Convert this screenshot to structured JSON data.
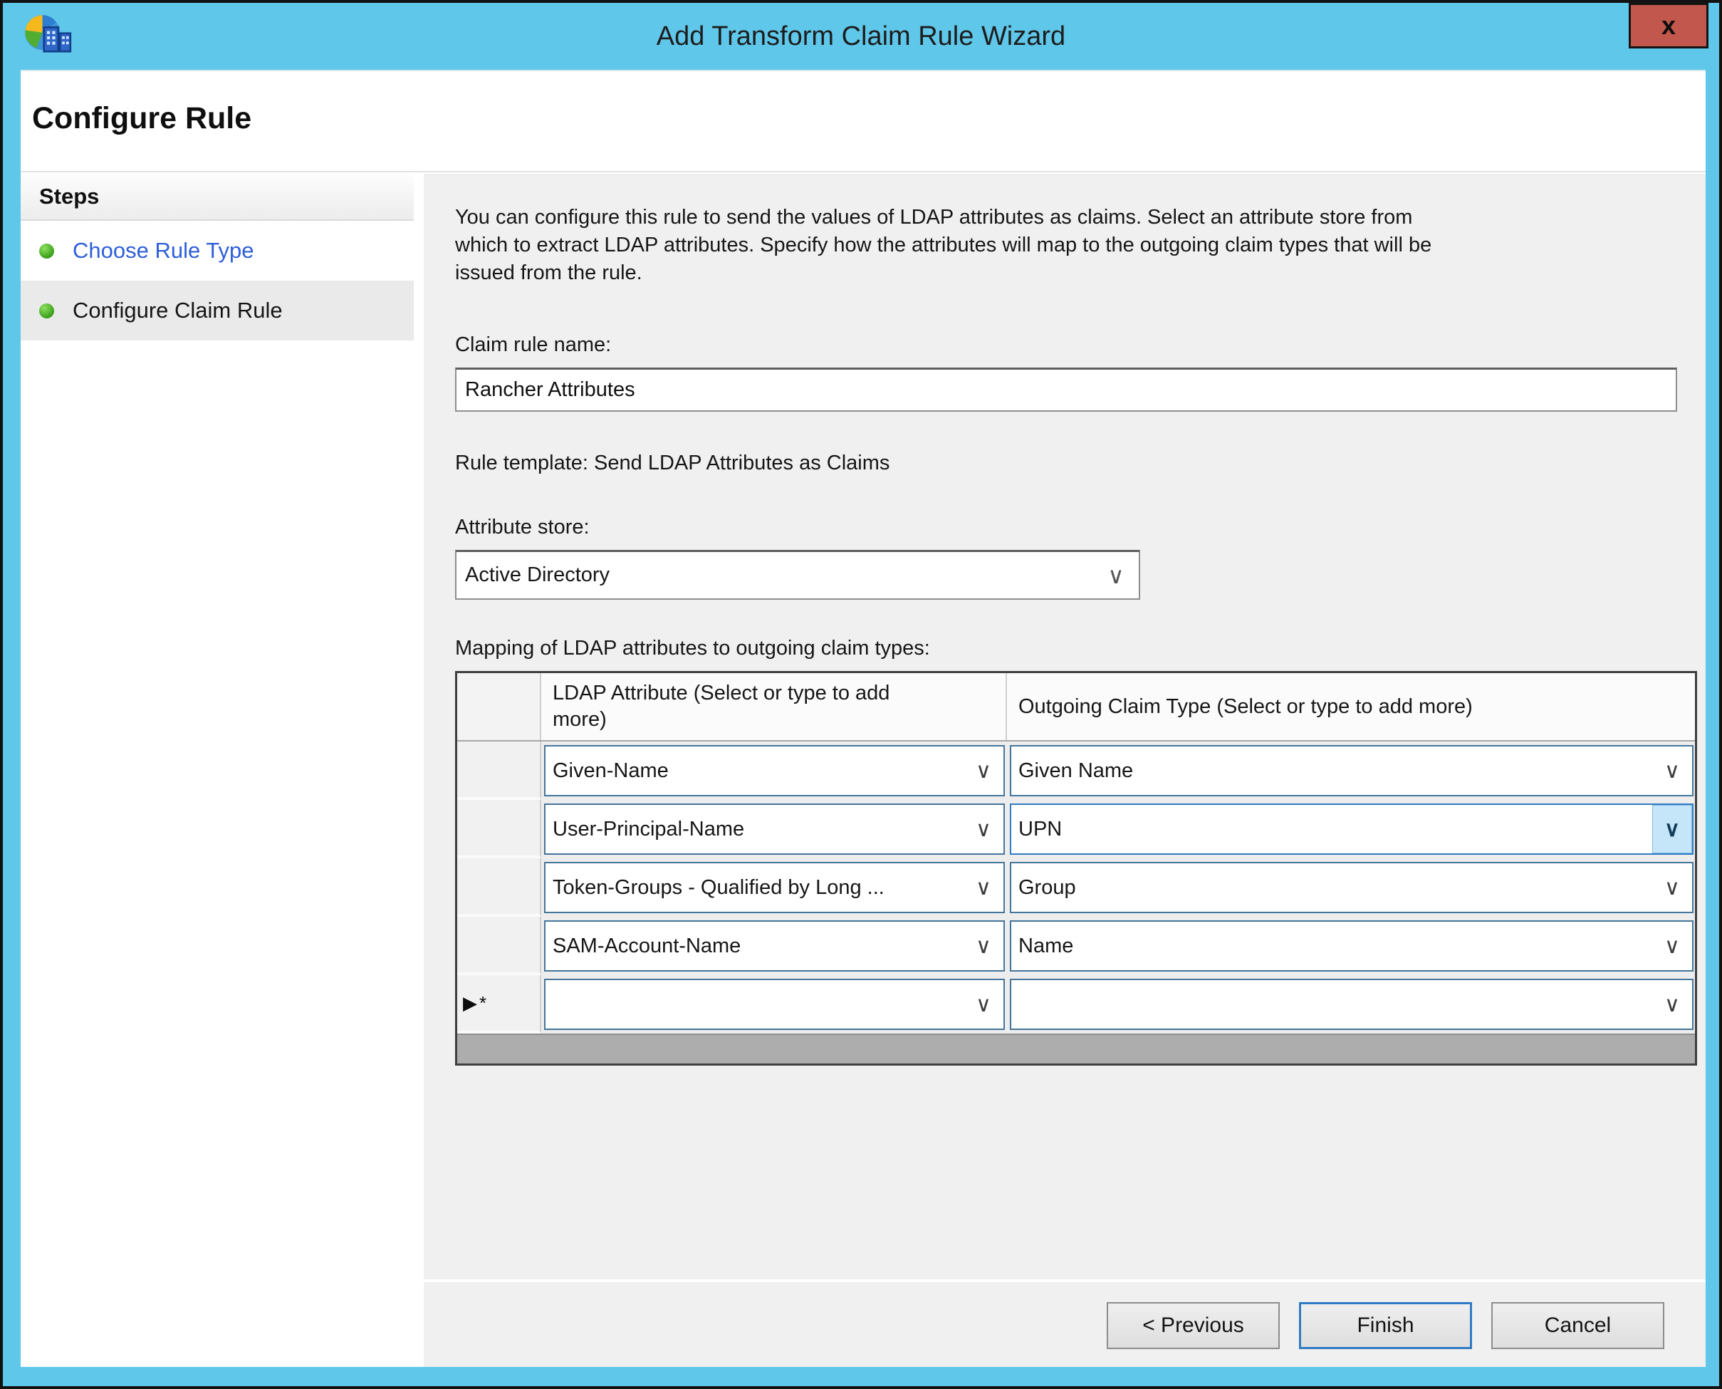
{
  "window": {
    "title": "Add Transform Claim Rule Wizard",
    "close_label": "x",
    "heading": "Configure Rule"
  },
  "sidebar": {
    "title": "Steps",
    "items": [
      {
        "label": "Choose Rule Type",
        "current": false
      },
      {
        "label": "Configure Claim Rule",
        "current": true
      }
    ]
  },
  "main": {
    "description_lines": [
      "You can configure this rule to send the values of LDAP attributes as claims. Select an attribute store from",
      "which to extract LDAP attributes. Specify how the attributes will map to the outgoing claim types that will be",
      "issued from the rule."
    ],
    "claim_rule_name": {
      "label": "Claim rule name:",
      "value": "Rancher Attributes"
    },
    "rule_template": "Rule template: Send LDAP Attributes as Claims",
    "attribute_store": {
      "label": "Attribute store:",
      "value": "Active Directory"
    },
    "mapping_label": "Mapping of LDAP attributes to outgoing claim types:",
    "table": {
      "ldap_header": "LDAP Attribute (Select or type to add more)",
      "claim_header": "Outgoing Claim Type (Select or type to add more)",
      "chevron": "∨",
      "rows": [
        {
          "ldap": "Given-Name",
          "claim": "Given Name"
        },
        {
          "ldap": "User-Principal-Name",
          "claim": "UPN",
          "focused": "claim"
        },
        {
          "ldap": "Token-Groups - Qualified by Long ...",
          "claim": "Group"
        },
        {
          "ldap": "SAM-Account-Name",
          "claim": "Name"
        },
        {
          "ldap": "",
          "claim": "",
          "marker": "▶*"
        }
      ]
    }
  },
  "footer": {
    "buttons": [
      {
        "label": "< Previous",
        "default": false
      },
      {
        "label": "Finish",
        "default": true
      },
      {
        "label": "Cancel",
        "default": false
      }
    ]
  },
  "colors": {
    "titlebar": "#5FC7E9",
    "close_button": "#C1574D",
    "link": "#2E5FD9",
    "step_dot": "#3FA41F",
    "content_bg": "#F0F0F0",
    "combo_border": "#44759B",
    "focus_fill": "#C4E6F8",
    "finish_border": "#2F7BC3"
  }
}
